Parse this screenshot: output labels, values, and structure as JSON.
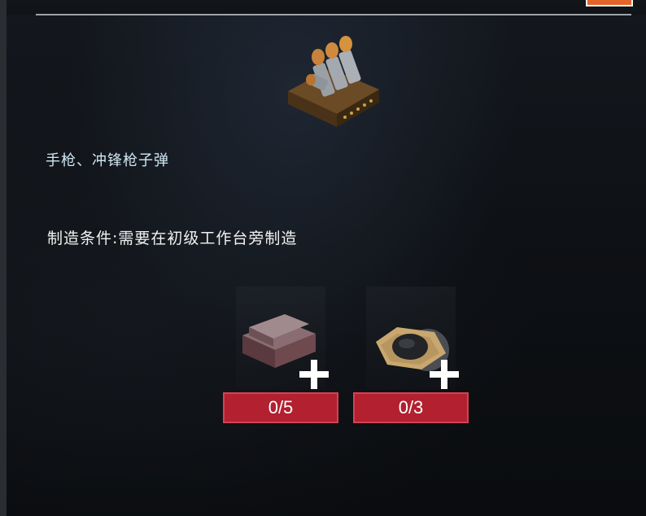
{
  "item": {
    "description": "手枪、冲锋枪子弹",
    "icon": "ammo-box-icon"
  },
  "crafting": {
    "condition": "制造条件:需要在初级工作台旁制造"
  },
  "materials": [
    {
      "icon": "metal-ingot-icon",
      "count": "0/5"
    },
    {
      "icon": "coal-cloth-icon",
      "count": "0/3"
    }
  ],
  "colors": {
    "accent_orange": "#e2642a",
    "count_red": "#b3202f",
    "desc_text": "#cfe6f2"
  }
}
